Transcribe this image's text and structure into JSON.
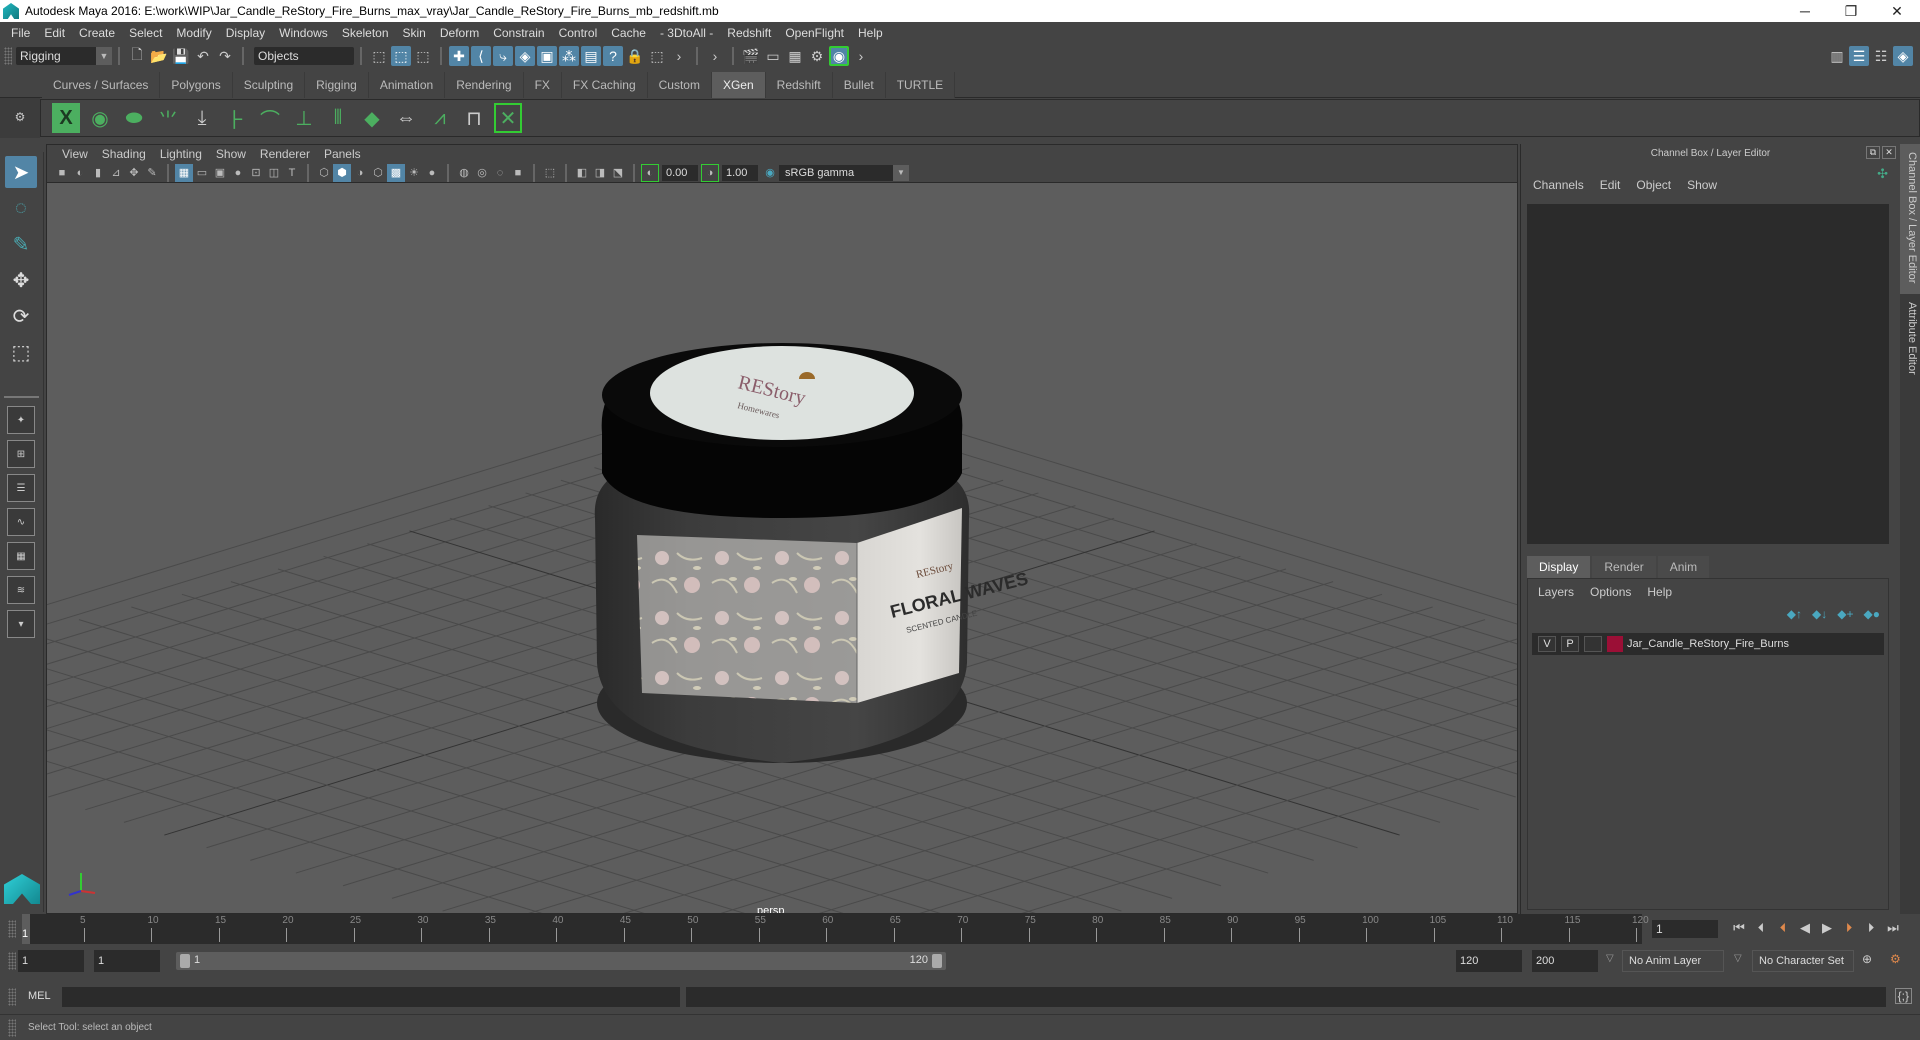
{
  "window": {
    "title": "Autodesk Maya 2016: E:\\work\\WIP\\Jar_Candle_ReStory_Fire_Burns_max_vray\\Jar_Candle_ReStory_Fire_Burns_mb_redshift.mb",
    "minimize": "─",
    "restore": "❐",
    "close": "✕"
  },
  "menubar": [
    "File",
    "Edit",
    "Create",
    "Select",
    "Modify",
    "Display",
    "Windows",
    "Skeleton",
    "Skin",
    "Deform",
    "Constrain",
    "Control",
    "Cache",
    "- 3DtoAll -",
    "Redshift",
    "OpenFlight",
    "Help"
  ],
  "statusline": {
    "menuset": "Rigging",
    "selection_mode": "Objects"
  },
  "shelf": {
    "tabs": [
      "Curves / Surfaces",
      "Polygons",
      "Sculpting",
      "Rigging",
      "Animation",
      "Rendering",
      "FX",
      "FX Caching",
      "Custom",
      "XGen",
      "Redshift",
      "Bullet",
      "TURTLE"
    ],
    "active_tab": "XGen",
    "icons": [
      "xgen-window-icon",
      "xgen-preview-icon",
      "xgen-hide-icon",
      "add-guides-icon",
      "place-guides-icon",
      "add-guide-icon",
      "show-guide-icon",
      "lock-guide-icon",
      "guide-split-icon",
      "region-map-icon",
      "flip-guides-icon",
      "select-guides-icon",
      "guide-cvs-icon",
      "delete-guides-icon"
    ]
  },
  "viewport": {
    "menu": [
      "View",
      "Shading",
      "Lighting",
      "Show",
      "Renderer",
      "Panels"
    ],
    "exposure": "0.00",
    "gamma": "1.00",
    "color_space": "sRGB gamma",
    "camera": "persp",
    "scene": {
      "lid_label_brand": "REStory",
      "lid_label_sub": "Homewares",
      "jar_label_title": "FLORAL WAVES",
      "jar_label_subtitle": "SCENTED CANDLE",
      "jar_label_brand": "REStory"
    }
  },
  "channelbox": {
    "title": "Channel Box / Layer Editor",
    "menu": [
      "Channels",
      "Edit",
      "Object",
      "Show"
    ],
    "layer_tabs": [
      "Display",
      "Render",
      "Anim"
    ],
    "active_layer_tab": "Display",
    "layer_menu": [
      "Layers",
      "Options",
      "Help"
    ],
    "layers": [
      {
        "visible": "V",
        "playback": "P",
        "color": "#9b0f36",
        "name": "Jar_Candle_ReStory_Fire_Burns"
      }
    ]
  },
  "sidetabs": [
    "Channel Box / Layer Editor",
    "Attribute Editor"
  ],
  "timeline": {
    "ticks": [
      5,
      10,
      15,
      20,
      25,
      30,
      35,
      40,
      45,
      50,
      55,
      60,
      65,
      70,
      75,
      80,
      85,
      90,
      95,
      100,
      105,
      110,
      115,
      120
    ],
    "current_frame": "1",
    "current_frame_field": "1"
  },
  "range": {
    "start": "1",
    "playback_start": "1",
    "slider_start": "1",
    "slider_end": "120",
    "playback_end": "120",
    "end": "200",
    "anim_layer": "No Anim Layer",
    "character_set": "No Character Set"
  },
  "cmdline": {
    "label": "MEL"
  },
  "helpline": {
    "text": "Select Tool: select an object"
  }
}
